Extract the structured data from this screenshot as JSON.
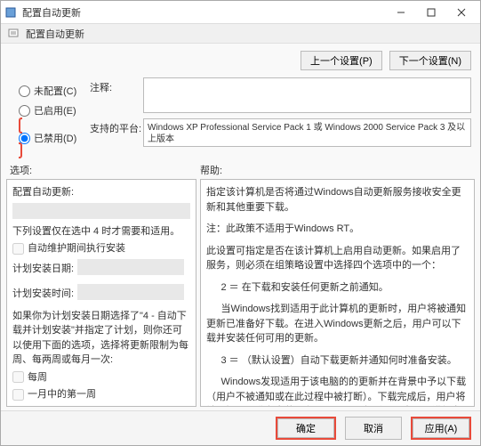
{
  "window": {
    "title": "配置自动更新",
    "subtitle": "配置自动更新"
  },
  "nav": {
    "prev": "上一个设置(P)",
    "next": "下一个设置(N)"
  },
  "radios": {
    "not_configured": "未配置(C)",
    "enabled": "已启用(E)",
    "disabled": "已禁用(D)"
  },
  "labels": {
    "comment": "注释:",
    "platform": "支持的平台:",
    "options": "选项:",
    "help": "帮助:"
  },
  "platform_text": "Windows XP Professional Service Pack 1 或 Windows 2000 Service Pack 3 及以上版本",
  "options_panel": {
    "heading": "配置自动更新:",
    "note": "下列设置仅在选中 4 时才需要和适用。",
    "maintenance": "自动维护期间执行安装",
    "schedule_day": "计划安装日期:",
    "schedule_time": "计划安装时间:",
    "long_note": "如果你为计划安装日期选择了\"4 - 自动下载并计划安装\"并指定了计划，则你还可以使用下面的选项，选择将更新限制为每周、每两周或每月一次:",
    "weekly": "每周",
    "first_week": "一月中的第一周"
  },
  "help_panel": {
    "p1": "指定该计算机是否将通过Windows自动更新服务接收安全更新和其他重要下载。",
    "p2": "注：此政策不适用于Windows RT。",
    "p3": "此设置可指定是否在该计算机上启用自动更新。如果启用了服务，则必须在组策略设置中选择四个选项中的一个：",
    "p4": "2 ＝ 在下载和安装任何更新之前通知。",
    "p5": "当Windows找到适用于此计算机的更新时，用户将被通知更新已准备好下载。在进入Windows更新之后，用户可以下载并安装任何可用的更新。",
    "p6": "3 ＝ （默认设置）自动下载更新并通知何时准备安装。",
    "p7": "Windows发现适用于该电脑的的更新并在背景中予以下载（用户不被通知或在此过程中被打断）。下载完成后，用户将被通知可以准备安装。在Windows更新后，用户可以进行安装。"
  },
  "footer": {
    "ok": "确定",
    "cancel": "取消",
    "apply": "应用(A)"
  }
}
